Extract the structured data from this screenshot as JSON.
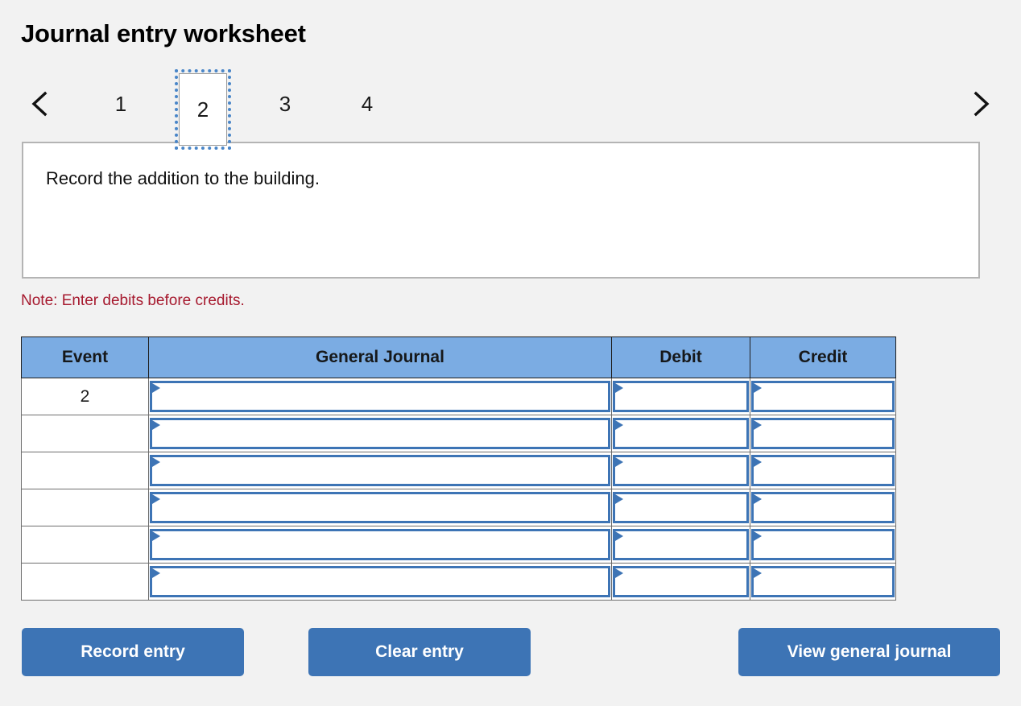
{
  "page": {
    "title": "Journal entry worksheet",
    "background_color": "#f2f2f2"
  },
  "nav": {
    "prev_icon": "chevron-left-icon",
    "next_icon": "chevron-right-icon",
    "tabs": [
      {
        "label": "1",
        "active": false
      },
      {
        "label": "2",
        "active": true
      },
      {
        "label": "3",
        "active": false
      },
      {
        "label": "4",
        "active": false
      }
    ],
    "active_tab": "2"
  },
  "prompt": {
    "text": "Record the addition to the building."
  },
  "note": {
    "text": "Note: Enter debits before credits.",
    "color": "#a6192e"
  },
  "journal_table": {
    "header_color": "#7bace3",
    "columns": [
      "Event",
      "General Journal",
      "Debit",
      "Credit"
    ],
    "rows": [
      {
        "event": "2",
        "general_journal": "",
        "debit": "",
        "credit": ""
      },
      {
        "event": "",
        "general_journal": "",
        "debit": "",
        "credit": ""
      },
      {
        "event": "",
        "general_journal": "",
        "debit": "",
        "credit": ""
      },
      {
        "event": "",
        "general_journal": "",
        "debit": "",
        "credit": ""
      },
      {
        "event": "",
        "general_journal": "",
        "debit": "",
        "credit": ""
      },
      {
        "event": "",
        "general_journal": "",
        "debit": "",
        "credit": ""
      }
    ]
  },
  "buttons": {
    "record": "Record entry",
    "clear": "Clear entry",
    "view": "View general journal",
    "color": "#3d74b5"
  }
}
